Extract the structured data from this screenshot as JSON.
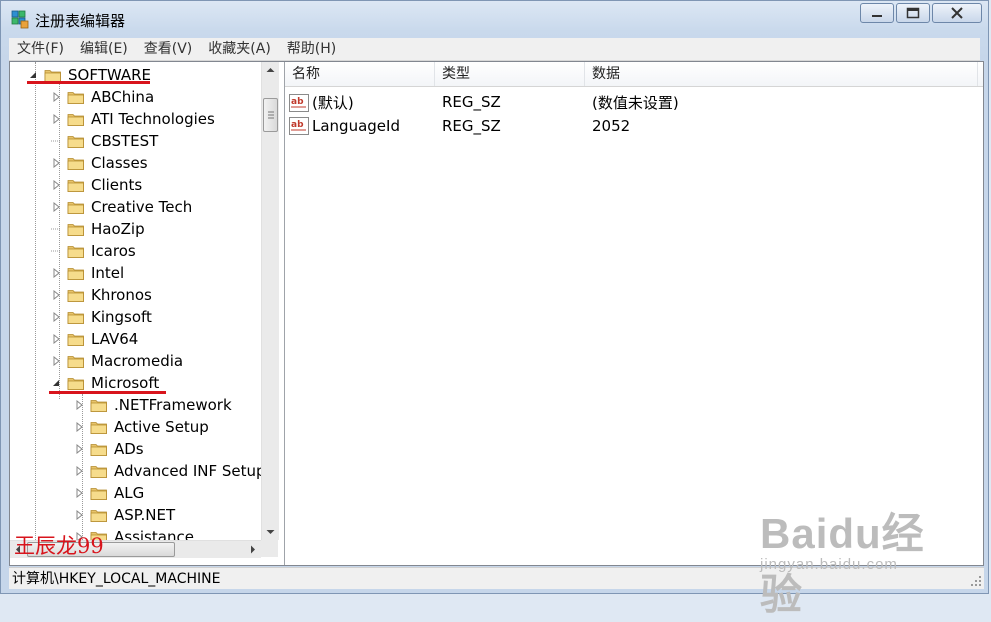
{
  "window": {
    "title": "注册表编辑器"
  },
  "menu": [
    "文件(F)",
    "编辑(E)",
    "查看(V)",
    "收藏夹(A)",
    "帮助(H)"
  ],
  "tree": [
    {
      "label": "SOFTWARE",
      "level": 0,
      "expander": "expanded"
    },
    {
      "label": "ABChina",
      "level": 1,
      "expander": "collapsed"
    },
    {
      "label": "ATI Technologies",
      "level": 1,
      "expander": "collapsed"
    },
    {
      "label": "CBSTEST",
      "level": 1,
      "expander": "none"
    },
    {
      "label": "Classes",
      "level": 1,
      "expander": "collapsed"
    },
    {
      "label": "Clients",
      "level": 1,
      "expander": "collapsed"
    },
    {
      "label": "Creative Tech",
      "level": 1,
      "expander": "collapsed"
    },
    {
      "label": "HaoZip",
      "level": 1,
      "expander": "none"
    },
    {
      "label": "Icaros",
      "level": 1,
      "expander": "none"
    },
    {
      "label": "Intel",
      "level": 1,
      "expander": "collapsed"
    },
    {
      "label": "Khronos",
      "level": 1,
      "expander": "collapsed"
    },
    {
      "label": "Kingsoft",
      "level": 1,
      "expander": "collapsed"
    },
    {
      "label": "LAV64",
      "level": 1,
      "expander": "collapsed"
    },
    {
      "label": "Macromedia",
      "level": 1,
      "expander": "collapsed"
    },
    {
      "label": "Microsoft",
      "level": 1,
      "expander": "expanded"
    },
    {
      "label": ".NETFramework",
      "level": 2,
      "expander": "collapsed"
    },
    {
      "label": "Active Setup",
      "level": 2,
      "expander": "collapsed"
    },
    {
      "label": "ADs",
      "level": 2,
      "expander": "collapsed"
    },
    {
      "label": "Advanced INF Setup",
      "level": 2,
      "expander": "collapsed"
    },
    {
      "label": "ALG",
      "level": 2,
      "expander": "collapsed"
    },
    {
      "label": "ASP.NET",
      "level": 2,
      "expander": "collapsed"
    },
    {
      "label": "Assistance",
      "level": 2,
      "expander": "collapsed"
    }
  ],
  "list": {
    "columns": [
      "名称",
      "类型",
      "数据"
    ],
    "rows": [
      {
        "name": "(默认)",
        "type": "REG_SZ",
        "data": "(数值未设置)",
        "icon": "string-value-icon"
      },
      {
        "name": "LanguageId",
        "type": "REG_SZ",
        "data": "2052",
        "icon": "string-value-icon"
      }
    ]
  },
  "status": {
    "path": "计算机\\HKEY_LOCAL_MACHINE"
  },
  "annotations": {
    "handwriting": "王辰龙99",
    "watermark_brand": "Baidu经验",
    "watermark_url": "jingyan.baidu.com",
    "color": "#d8141c"
  }
}
